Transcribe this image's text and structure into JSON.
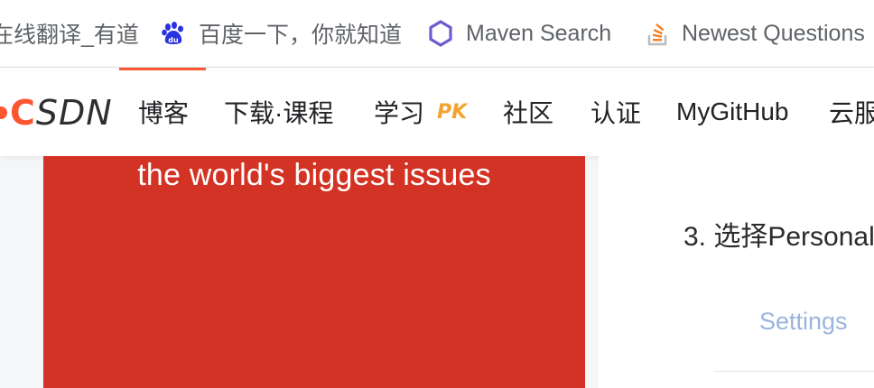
{
  "bookmarks": [
    {
      "label": "在线翻译_有道",
      "icon": "youdao-icon"
    },
    {
      "label": "百度一下，你就知道",
      "icon": "baidu-paw-icon"
    },
    {
      "label": "Maven Search",
      "icon": "maven-hexagon-icon"
    },
    {
      "label": "Newest Questions",
      "icon": "stackoverflow-icon"
    }
  ],
  "csdn": {
    "logo_text": "CSDN",
    "nav": [
      {
        "label": "博客"
      },
      {
        "label": "下载·课程"
      },
      {
        "label": "学习",
        "badge": "PK"
      },
      {
        "label": "社区"
      },
      {
        "label": "认证"
      },
      {
        "label": "MyGitHub"
      },
      {
        "label": "云服"
      }
    ],
    "accent": "#fc5531"
  },
  "banner": {
    "text": "the world's biggest issues",
    "bg": "#d33324"
  },
  "article": {
    "step": "3. 选择Personal",
    "image_word": "Settings"
  }
}
